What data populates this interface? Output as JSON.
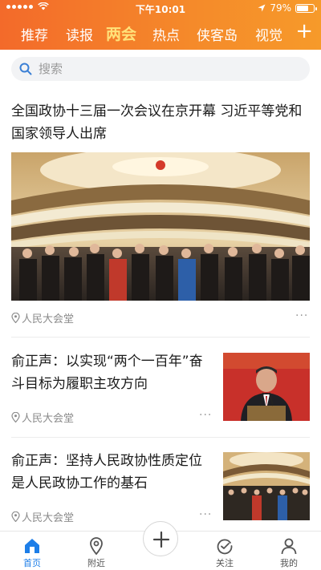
{
  "status_bar": {
    "time": "下午10:01",
    "battery": "79%",
    "battery_level": 0.79
  },
  "tabs": [
    {
      "label": "推荐",
      "active": false
    },
    {
      "label": "读报",
      "active": false
    },
    {
      "label": "两会",
      "active": true
    },
    {
      "label": "热点",
      "active": false
    },
    {
      "label": "侠客岛",
      "active": false
    },
    {
      "label": "视觉",
      "active": false
    }
  ],
  "tab_add_label": "+",
  "search": {
    "placeholder": "搜索",
    "icon": "search-icon"
  },
  "articles": [
    {
      "title": "全国政协十三届一次会议在京开幕 习近平等党和国家领导人出席",
      "location": "人民大会堂",
      "more": "···",
      "image": "great-hall-assembly-photo"
    },
    {
      "title": "俞正声：以实现“两个一百年”奋斗目标为履职主攻方向",
      "location": "人民大会堂",
      "more": "···",
      "image": "speaker-at-podium-photo"
    },
    {
      "title": "俞正声：坚持人民政协性质定位是人民政协工作的基石",
      "location": "人民大会堂",
      "more": "···",
      "image": "great-hall-assembly-thumb"
    }
  ],
  "bottom_nav": [
    {
      "label": "首页",
      "icon": "home-icon",
      "active": true
    },
    {
      "label": "附近",
      "icon": "location-pin-icon",
      "active": false
    },
    {
      "label": "",
      "icon": "add-icon",
      "active": false
    },
    {
      "label": "关注",
      "icon": "follow-icon",
      "active": false
    },
    {
      "label": "我的",
      "icon": "user-icon",
      "active": false
    }
  ],
  "colors": {
    "header_start": "#f36a2a",
    "header_end": "#f69a2a",
    "active_tab": "#ffe27a",
    "nav_active": "#1d7ee8",
    "meta_text": "#8a8a8a"
  }
}
